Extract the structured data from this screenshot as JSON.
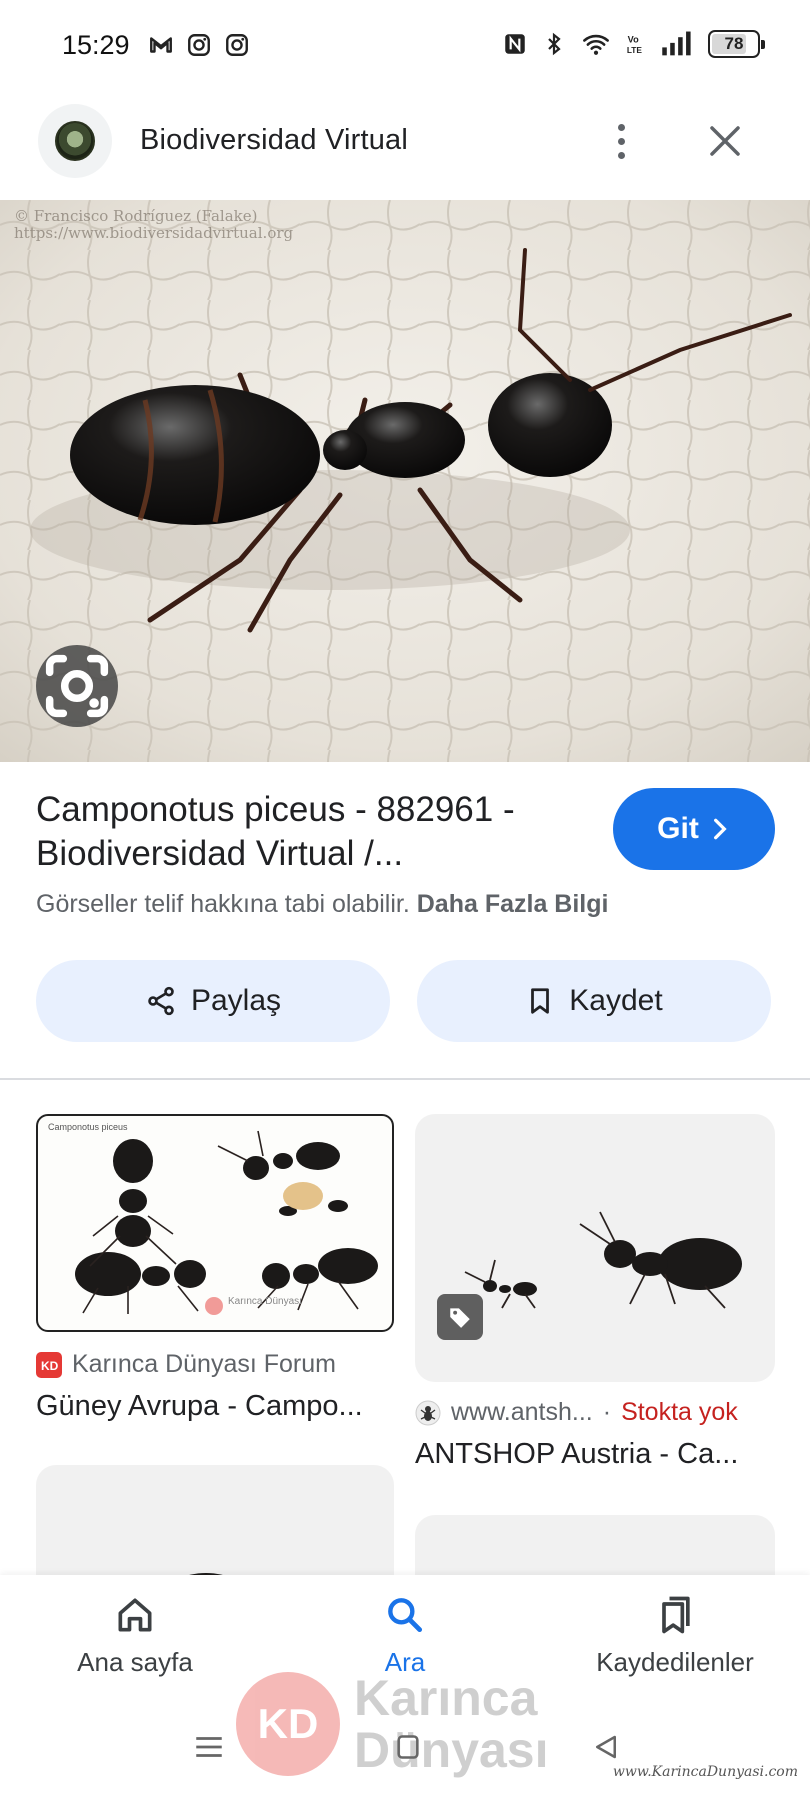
{
  "status_bar": {
    "time": "15:29",
    "app_icons": [
      "gmail-icon",
      "instagram-icon",
      "instagram-icon"
    ],
    "system_icons": [
      "nfc-icon",
      "bluetooth-icon",
      "wifi-icon",
      "volte-icon",
      "signal-icon"
    ],
    "battery_level": 78,
    "battery_text": "78",
    "volte_text": "Vo LTE"
  },
  "header": {
    "title": "Biodiversidad Virtual",
    "more_icon": "more-vert-icon",
    "close_icon": "close-icon"
  },
  "main_image": {
    "watermark_line1": "© Francisco Rodríguez (Falake)",
    "watermark_line2": "https://www.biodiversidadvirtual.org",
    "lens_icon": "google-lens-icon"
  },
  "result": {
    "title_line1": "Camponotus piceus - 882961 -",
    "title_line2": "Biodiversidad Virtual /...",
    "go_label": "Git",
    "copyright_text": "Görseller telif hakkına tabi olabilir.",
    "learn_more": "Daha Fazla Bilgi"
  },
  "actions": {
    "share_label": "Paylaş",
    "save_label": "Kaydet"
  },
  "related": [
    {
      "source": "Karınca Dünyası Forum",
      "title": "Güney Avrupa - Campo...",
      "image_caption": "Camponotus piceus",
      "image_watermark": "Karınca Dünyası"
    },
    {
      "source": "www.antsh...",
      "stock": "Stokta yok",
      "title": "ANTSHOP Austria - Ca..."
    }
  ],
  "bottom_nav": {
    "home": "Ana sayfa",
    "search": "Ara",
    "saved": "Kaydedilenler",
    "active": "search"
  },
  "overlay_watermark": {
    "logo_text": "KD",
    "line1": "Karınca",
    "line2": "Dünyası",
    "url": "www.KarincaDunyasi.com"
  },
  "colors": {
    "accent": "#1a73e8",
    "tonal_button": "#e8f0fe",
    "stock_red": "#c5221f",
    "secondary_text": "#5f6368"
  }
}
